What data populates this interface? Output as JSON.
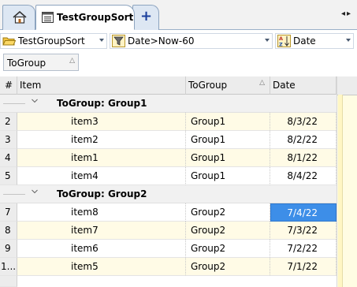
{
  "tabs": {
    "home_icon": "home-icon",
    "active_label": "TestGroupSort",
    "active_icon": "list-window-icon",
    "add_label": "+",
    "scroll_left": "◂",
    "scroll_right": "▸"
  },
  "toolbar": {
    "view_combo": {
      "icon": "folder-open-icon",
      "value": "TestGroupSort"
    },
    "filter_combo": {
      "icon": "filter-icon",
      "value": "Date>Now-60"
    },
    "sort_combo": {
      "icon": "sort-az-icon",
      "value": "Date"
    }
  },
  "grouping": {
    "chip_label": "ToGroup",
    "chip_sort_glyph": "△"
  },
  "grid": {
    "columns": [
      {
        "label": "#"
      },
      {
        "label": "Item"
      },
      {
        "label": "ToGroup",
        "sort_glyph": "△"
      },
      {
        "label": "Date"
      }
    ],
    "groups": [
      {
        "title": "ToGroup: Group1",
        "rows": [
          {
            "num": "2",
            "item": "item3",
            "group": "Group1",
            "date": "8/3/22"
          },
          {
            "num": "3",
            "item": "item2",
            "group": "Group1",
            "date": "8/2/22"
          },
          {
            "num": "4",
            "item": "item1",
            "group": "Group1",
            "date": "8/1/22"
          },
          {
            "num": "5",
            "item": "item4",
            "group": "Group1",
            "date": "8/4/22"
          }
        ]
      },
      {
        "title": "ToGroup: Group2",
        "rows": [
          {
            "num": "7",
            "item": "item8",
            "group": "Group2",
            "date": "7/4/22",
            "selected": true
          },
          {
            "num": "8",
            "item": "item7",
            "group": "Group2",
            "date": "7/3/22"
          },
          {
            "num": "9",
            "item": "item6",
            "group": "Group2",
            "date": "7/2/22"
          },
          {
            "num": "1...",
            "item": "item5",
            "group": "Group2",
            "date": "7/1/22"
          }
        ]
      }
    ]
  },
  "colors": {
    "selection": "#3d8ee8",
    "row_tint": "#fffbe6",
    "tab_border": "#8da4bf"
  }
}
